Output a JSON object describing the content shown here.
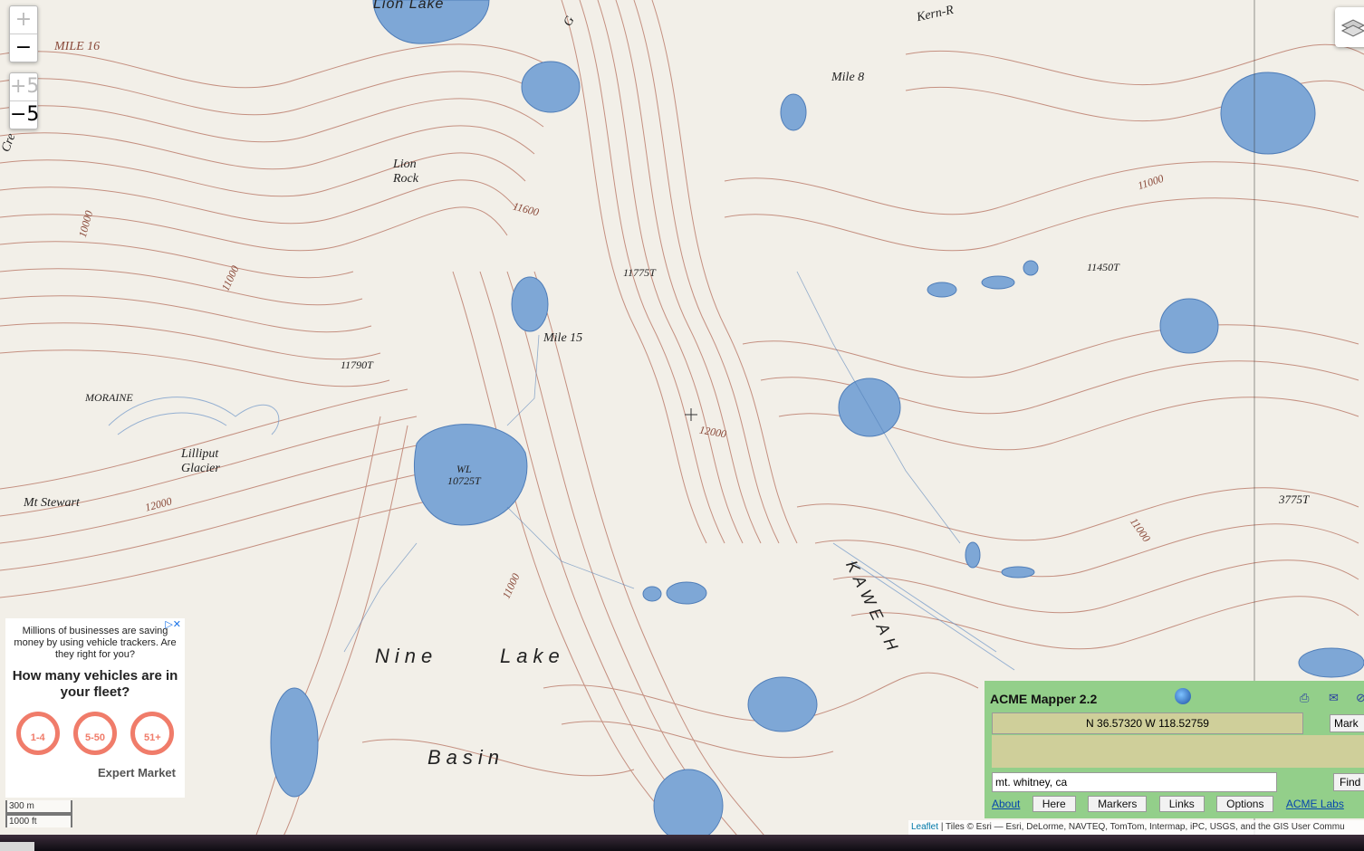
{
  "map": {
    "labels": {
      "lion_lake": "Lion   Lake",
      "kern": "Kern-R",
      "mile16": "MILE 16",
      "mile8": "Mile 8",
      "lion_rock": "Lion\nRock",
      "cre": "Cre",
      "g": "G",
      "e11600": "11600",
      "e11775": "11775T",
      "e11450": "11450T",
      "e11000": "11000",
      "mile15": "Mile 15",
      "e11790": "11790T",
      "moraine": "MORAINE",
      "lilliput": "Lilliput\nGlacier",
      "mt_stewart": "Mt Stewart",
      "e12000a": "12000",
      "wl": "WL\n10725T",
      "e12000b": "12000",
      "e11000b": "11000",
      "e3775": "3775T",
      "e11000c": "11000",
      "kaweah": "KAWEAH",
      "nine": "Nine",
      "lake": "Lake",
      "basin": "Basin",
      "e10000": "10000",
      "e11000d": "11000"
    }
  },
  "controls": {
    "zoom_in": "+",
    "zoom_out": "−",
    "zoom_in5": "+5",
    "zoom_out5": "−5"
  },
  "ad": {
    "line1": "Millions of businesses are saving money by using vehicle trackers. Are they right for you?",
    "headline": "How many vehicles are in your fleet?",
    "options": [
      "1-4",
      "5-50",
      "51+"
    ],
    "brand": "Expert Market",
    "close": "▷✕"
  },
  "scale": {
    "metric": "300 m",
    "imperial": "1000 ft"
  },
  "attribution": {
    "leaflet": "Leaflet",
    "text": "| Tiles © Esri — Esri, DeLorme, NAVTEQ, TomTom, Intermap, iPC, USGS, and the GIS User Commu"
  },
  "panel": {
    "title": "ACME Mapper 2.2",
    "coords": "N 36.57320 W 118.52759",
    "mark_label": "Mark",
    "search_value": "mt. whitney, ca",
    "find_label": "Find",
    "about": "About",
    "here": "Here",
    "markers": "Markers",
    "links": "Links",
    "options": "Options",
    "acme_labs": "ACME Labs"
  },
  "colors": {
    "contour": "#b5705e",
    "water": "#7ea7d6",
    "panel": "#93cf8a"
  }
}
